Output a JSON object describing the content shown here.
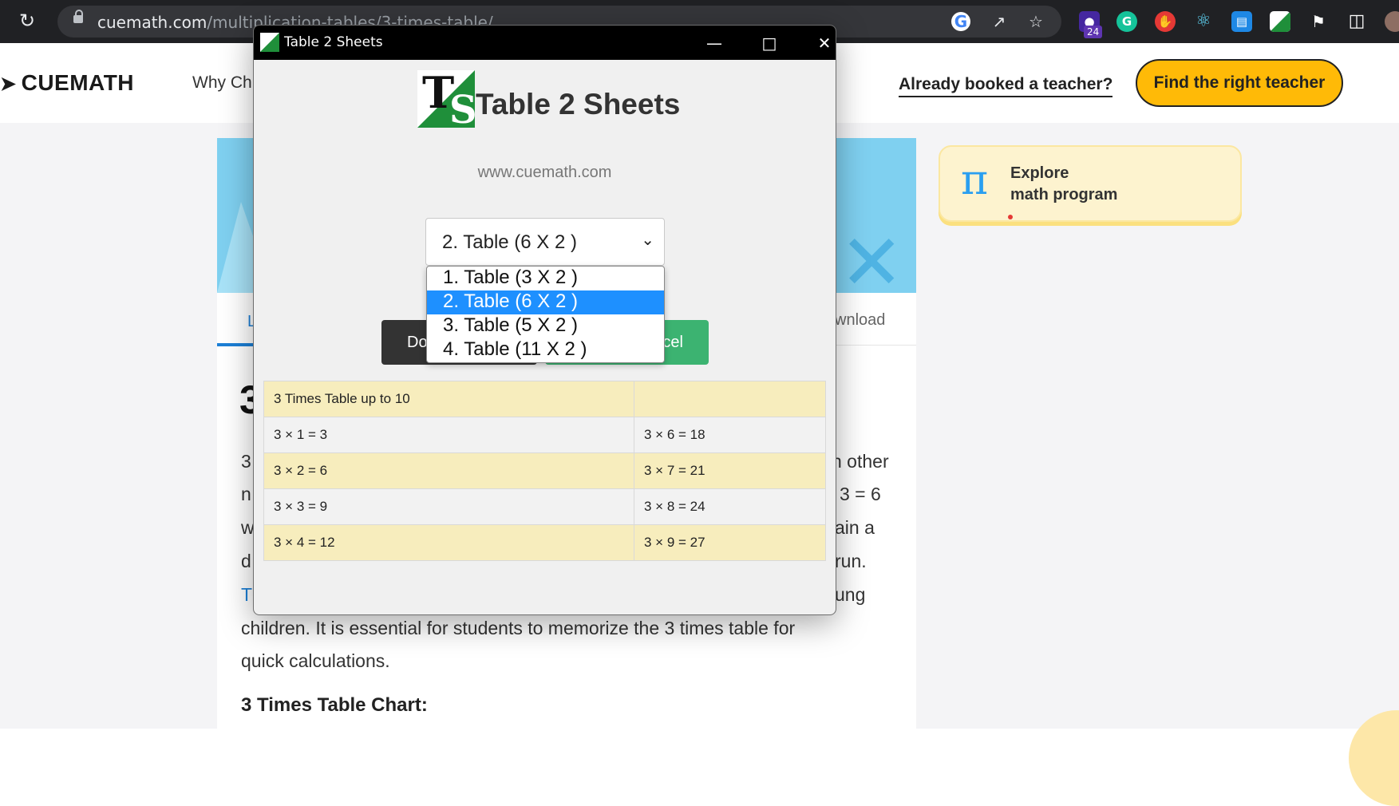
{
  "browser": {
    "url_domain": "cuemath.com",
    "url_path": "/multiplication-tables/3-times-table/",
    "extension_badge": "24"
  },
  "site": {
    "logo": "CUEMATH",
    "nav_why": "Why Ch",
    "booked_link": "Already booked a teacher?",
    "find_button": "Find the right teacher",
    "tab_partial_left": "L",
    "tab_download_partial": "wnload",
    "heading_partial": "3",
    "explore_line1": "Explore",
    "explore_line2": "math program",
    "para_lines": [
      {
        "left": "3",
        "right": "n other"
      },
      {
        "left": "n",
        "right": "3 = 6"
      },
      {
        "left": "w",
        "right": "ain a"
      },
      {
        "left": "d",
        "right": "run."
      },
      {
        "left": "T",
        "right": "ung"
      }
    ],
    "para_full_1": "children. It is essential for students to memorize the 3 times table for",
    "para_full_2": "quick calculations.",
    "chart_heading": "3 Times Table Chart:"
  },
  "app": {
    "window_title": "Table 2 Sheets",
    "title": "Table 2 Sheets",
    "website": "www.cuemath.com",
    "select_value": "2. Table (6 X 2 )",
    "download_button_partial": "Do",
    "cancel_button_partial": "cel",
    "dropdown_options": [
      "1. Table (3 X 2 )",
      "2. Table (6 X 2 )",
      "3. Table (5 X 2 )",
      "4. Table (11 X 2 )"
    ],
    "selected_index": 1,
    "table_header": [
      "3 Times Table up to 10",
      ""
    ],
    "table_rows": [
      [
        "3 × 1 = 3",
        "3 × 6 = 18"
      ],
      [
        "3 × 2 = 6",
        "3 × 7 = 21"
      ],
      [
        "3 × 3 = 9",
        "3 × 8 = 24"
      ],
      [
        "3 × 4 = 12",
        "3 × 9 = 27"
      ]
    ]
  },
  "colors": {
    "accent_yellow": "#ffba07",
    "selection_blue": "#1e90ff",
    "cancel_green": "#3cb371",
    "row_yellow": "#f7edbd"
  }
}
